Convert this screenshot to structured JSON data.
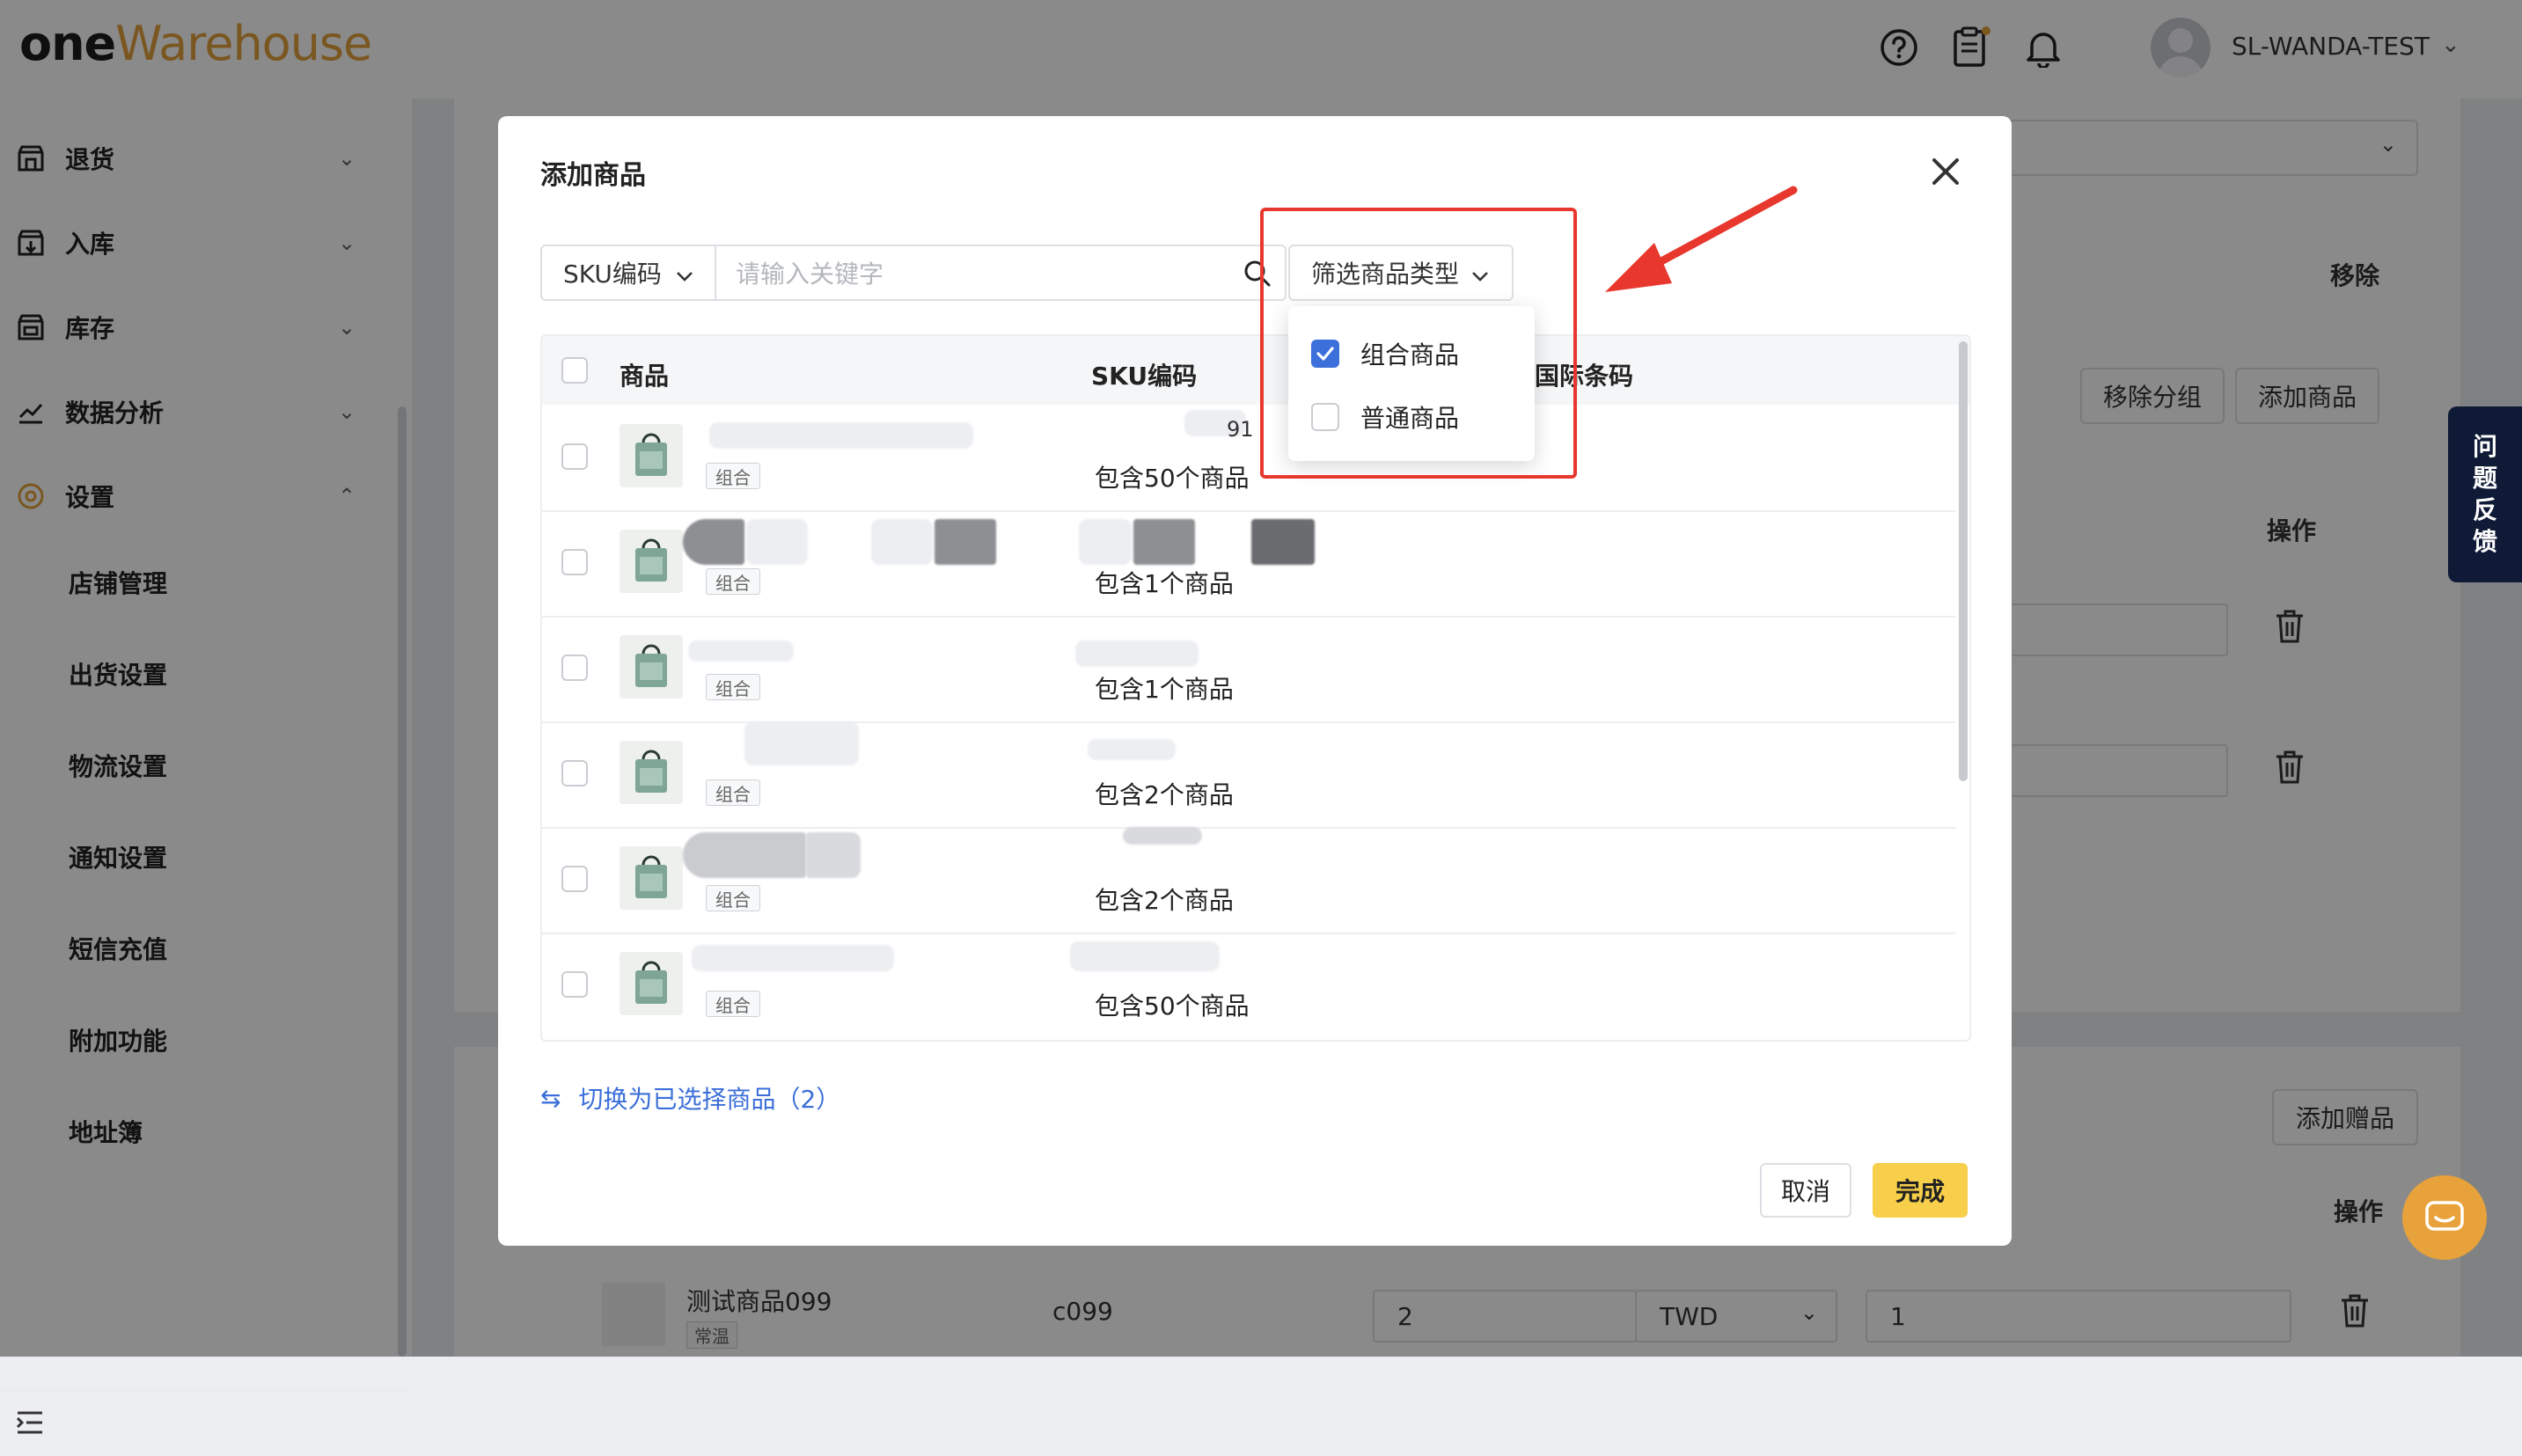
{
  "app": {
    "logo_one": "one",
    "logo_warehouse": "Warehouse",
    "username": "SL-WANDA-TEST",
    "brand_color": "#e2a23b"
  },
  "sidebar": {
    "items": [
      {
        "label": "退货",
        "icon": "return-icon"
      },
      {
        "label": "入库",
        "icon": "inbound-icon"
      },
      {
        "label": "库存",
        "icon": "inventory-icon"
      },
      {
        "label": "数据分析",
        "icon": "chart-icon"
      },
      {
        "label": "设置",
        "icon": "settings-icon"
      }
    ],
    "sub_items": [
      "店铺管理",
      "出货设置",
      "物流设置",
      "通知设置",
      "短信充值",
      "附加功能",
      "地址簿"
    ]
  },
  "background": {
    "remove_label": "移除",
    "remove_group_label": "移除分组",
    "add_product_label": "添加商品",
    "operation_label": "操作",
    "add_gift_label": "添加赠品",
    "operation_label_2": "操作",
    "row_name": "测试商品099",
    "row_tag": "常温",
    "row_sku": "c099",
    "row_qty": "2",
    "row_currency": "TWD",
    "row_value": "1"
  },
  "feedback_label": "问题反馈",
  "modal": {
    "title": "添加商品",
    "sku_select": "SKU编码",
    "search_placeholder": "请输入关键字",
    "filter_label": "筛选商品类型",
    "columns": [
      "商品",
      "SKU编码",
      "国际条码"
    ],
    "rows": [
      {
        "tag": "组合",
        "count": "包含50个商品"
      },
      {
        "tag": "组合",
        "count": "包含1个商品"
      },
      {
        "tag": "组合",
        "count": "包含1个商品"
      },
      {
        "tag": "组合",
        "count": "包含2个商品"
      },
      {
        "tag": "组合",
        "count": "包含2个商品"
      },
      {
        "tag": "组合",
        "count": "包含50个商品"
      }
    ],
    "partial_sku_text": "91",
    "switch_link": "切换为已选择商品（2）",
    "cancel": "取消",
    "done": "完成"
  },
  "filter_dropdown": {
    "options": [
      {
        "label": "组合商品",
        "checked": true
      },
      {
        "label": "普通商品",
        "checked": false
      }
    ]
  },
  "accent_color": "#3b6fd9",
  "annotation_color": "#e8382d"
}
